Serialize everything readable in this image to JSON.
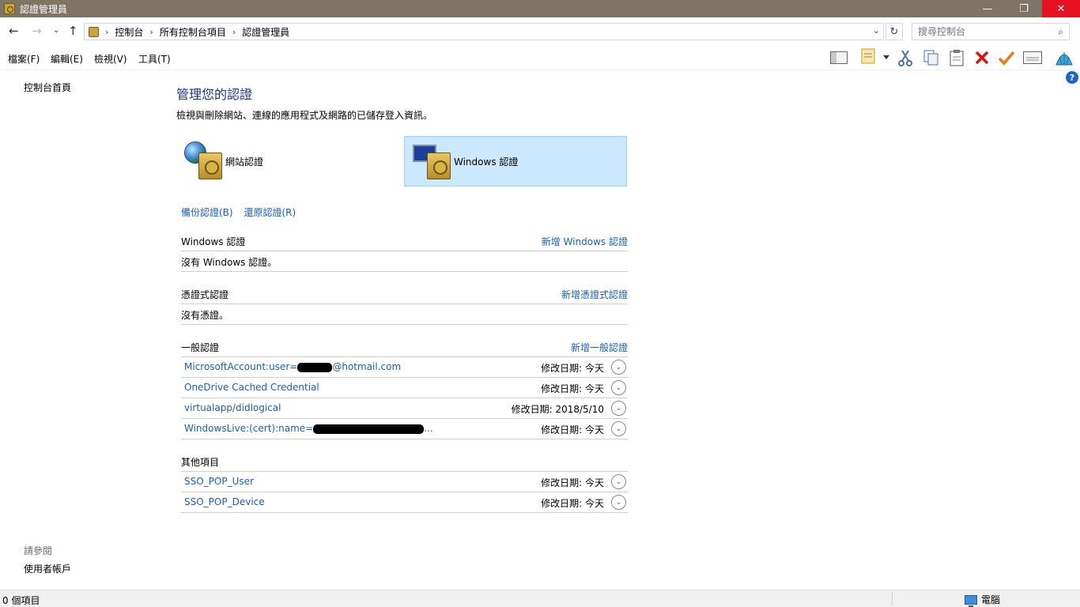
{
  "window": {
    "title": "認證管理員",
    "minimize_glyph": "—",
    "maximize_glyph": "❐",
    "close_glyph": "✕"
  },
  "address": {
    "breadcrumbs": [
      "控制台",
      "所有控制台項目",
      "認證管理員"
    ],
    "search_placeholder": "搜尋控制台"
  },
  "menu": {
    "file": "檔案(F)",
    "edit": "編輯(E)",
    "view": "檢視(V)",
    "tools": "工具(T)"
  },
  "toolbar_icons": [
    "layout-icon",
    "properties-icon",
    "cut-icon",
    "copy-icon",
    "paste-icon",
    "delete-icon",
    "check-icon",
    "card-icon",
    "shell-icon"
  ],
  "left": {
    "home": "控制台首頁",
    "see_also": "請參閱",
    "user_accounts": "使用者帳戶"
  },
  "main": {
    "title": "管理您的認證",
    "description": "檢視與刪除網站、連線的應用程式及網路的已儲存登入資訊。",
    "web_credentials": "網站認證",
    "windows_credentials": "Windows 認證",
    "backup": "備份認證(B)",
    "restore": "還原認證(R)"
  },
  "sections": {
    "windows": {
      "title": "Windows 認證",
      "add": "新增 Windows 認證",
      "empty": "沒有 Windows 認證。"
    },
    "certificate": {
      "title": "憑證式認證",
      "add": "新增憑證式認證",
      "empty": "沒有憑證。"
    },
    "generic": {
      "title": "一般認證",
      "add": "新增一般認證",
      "items": [
        {
          "name_prefix": "MicrosoftAccount:user=",
          "name_suffix": "@hotmail.com",
          "date": "修改日期:  今天"
        },
        {
          "name": "OneDrive Cached Credential",
          "date": "修改日期:  今天"
        },
        {
          "name": "virtualapp/didlogical",
          "date": "修改日期:  2018/5/10"
        },
        {
          "name_prefix": "WindowsLive:(cert):name=",
          "name_suffix": "...",
          "date": "修改日期:  今天"
        }
      ]
    },
    "other": {
      "title": "其他項目",
      "items": [
        {
          "name": "SSO_POP_User",
          "date": "修改日期:  今天"
        },
        {
          "name": "SSO_POP_Device",
          "date": "修改日期:  今天"
        }
      ]
    }
  },
  "status": {
    "items": "0 個項目",
    "location": "電腦"
  },
  "colors": {
    "titlebar": "#7e7565",
    "close": "#e81123",
    "link": "#1a5fb4",
    "heading": "#1e3287",
    "selected_bg": "#cce8ff"
  }
}
